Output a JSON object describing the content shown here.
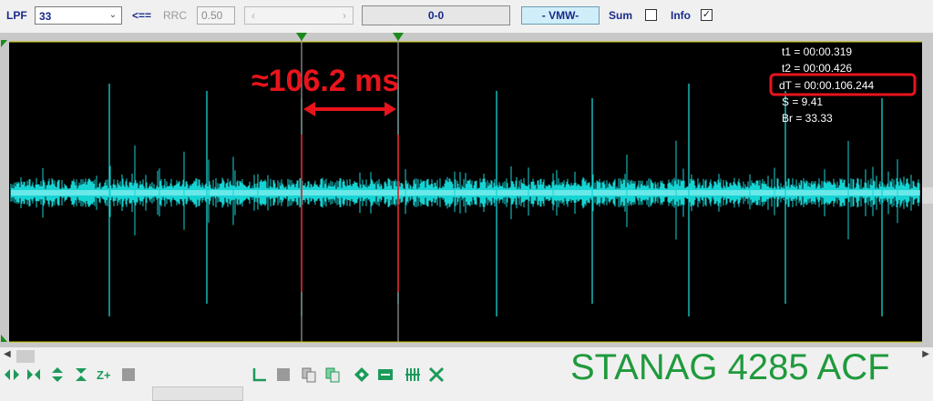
{
  "toolbar": {
    "lpf_label": "LPF",
    "lpf_value": "33",
    "arrow_label": "<==",
    "rrc_label": "RRC",
    "rrc_value": "0.50",
    "range_label": "0-0",
    "mode_label": "- VMW-",
    "sum_label": "Sum",
    "sum_checked": false,
    "info_label": "Info",
    "info_checked": true
  },
  "scope": {
    "info_lines": [
      "t1 = 00:00.319",
      "t2 = 00:00.426",
      "dT = 00:00.106.244",
      "S = 9.41",
      "Br = 33.33"
    ],
    "annotation": "≈106.2 ms",
    "colors": {
      "background": "#000000",
      "trace": "#17d4d4",
      "cursor": "#aaaaaa",
      "annotation": "#e8141c",
      "marker": "#1a8a1a"
    }
  },
  "footer": {
    "caption": "STANAG 4285 ACF",
    "caption_color": "#1f9a3c",
    "icons": [
      "expand-horizontal-icon",
      "shrink-horizontal-icon",
      "expand-vertical-icon",
      "shrink-vertical-icon",
      "zoom-plus-icon",
      "stop-icon",
      "marker-icon",
      "stop2-icon",
      "copy-icon",
      "copy2-icon",
      "diamond-icon",
      "minus-box-icon",
      "grid-icon",
      "cross-icon"
    ]
  }
}
